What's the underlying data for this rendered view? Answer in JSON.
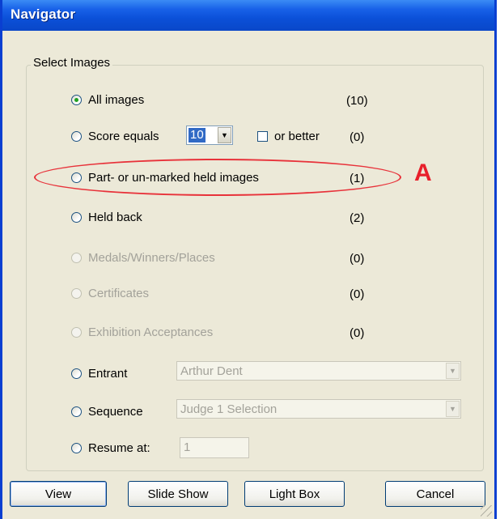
{
  "window": {
    "title": "Navigator"
  },
  "group": {
    "label": "Select Images"
  },
  "options": [
    {
      "label": "All images",
      "count": "(10)",
      "checked": true,
      "enabled": true
    },
    {
      "label": "Score equals",
      "count": "(0)",
      "checked": false,
      "enabled": true
    },
    {
      "label": "Part- or un-marked held images",
      "count": "(1)",
      "checked": false,
      "enabled": true
    },
    {
      "label": "Held back",
      "count": "(2)",
      "checked": false,
      "enabled": true
    },
    {
      "label": "Medals/Winners/Places",
      "count": "(0)",
      "checked": false,
      "enabled": false
    },
    {
      "label": "Certificates",
      "count": "(0)",
      "checked": false,
      "enabled": false
    },
    {
      "label": "Exhibition Acceptances",
      "count": "(0)",
      "checked": false,
      "enabled": false
    },
    {
      "label": "Entrant",
      "checked": false,
      "enabled": true
    },
    {
      "label": "Sequence",
      "checked": false,
      "enabled": true
    },
    {
      "label": "Resume at:",
      "checked": false,
      "enabled": true
    }
  ],
  "score": {
    "value": "10",
    "or_better_label": "or better",
    "or_better_checked": false
  },
  "entrant": {
    "value": "Arthur Dent",
    "enabled": false
  },
  "sequence": {
    "value": "Judge 1 Selection",
    "enabled": false
  },
  "resume": {
    "value": "1",
    "enabled": false
  },
  "buttons": {
    "view": "View",
    "slide_show": "Slide Show",
    "light_box": "Light Box",
    "cancel": "Cancel"
  },
  "annotation": {
    "letter": "A",
    "color": "#e8202b"
  },
  "colors": {
    "titlebar": "#0b50d8",
    "dialog_bg": "#ece9d8",
    "radio_dot": "#21a121",
    "selection": "#316ac5"
  },
  "icons": {
    "dropdown": "chevron-down-icon"
  }
}
